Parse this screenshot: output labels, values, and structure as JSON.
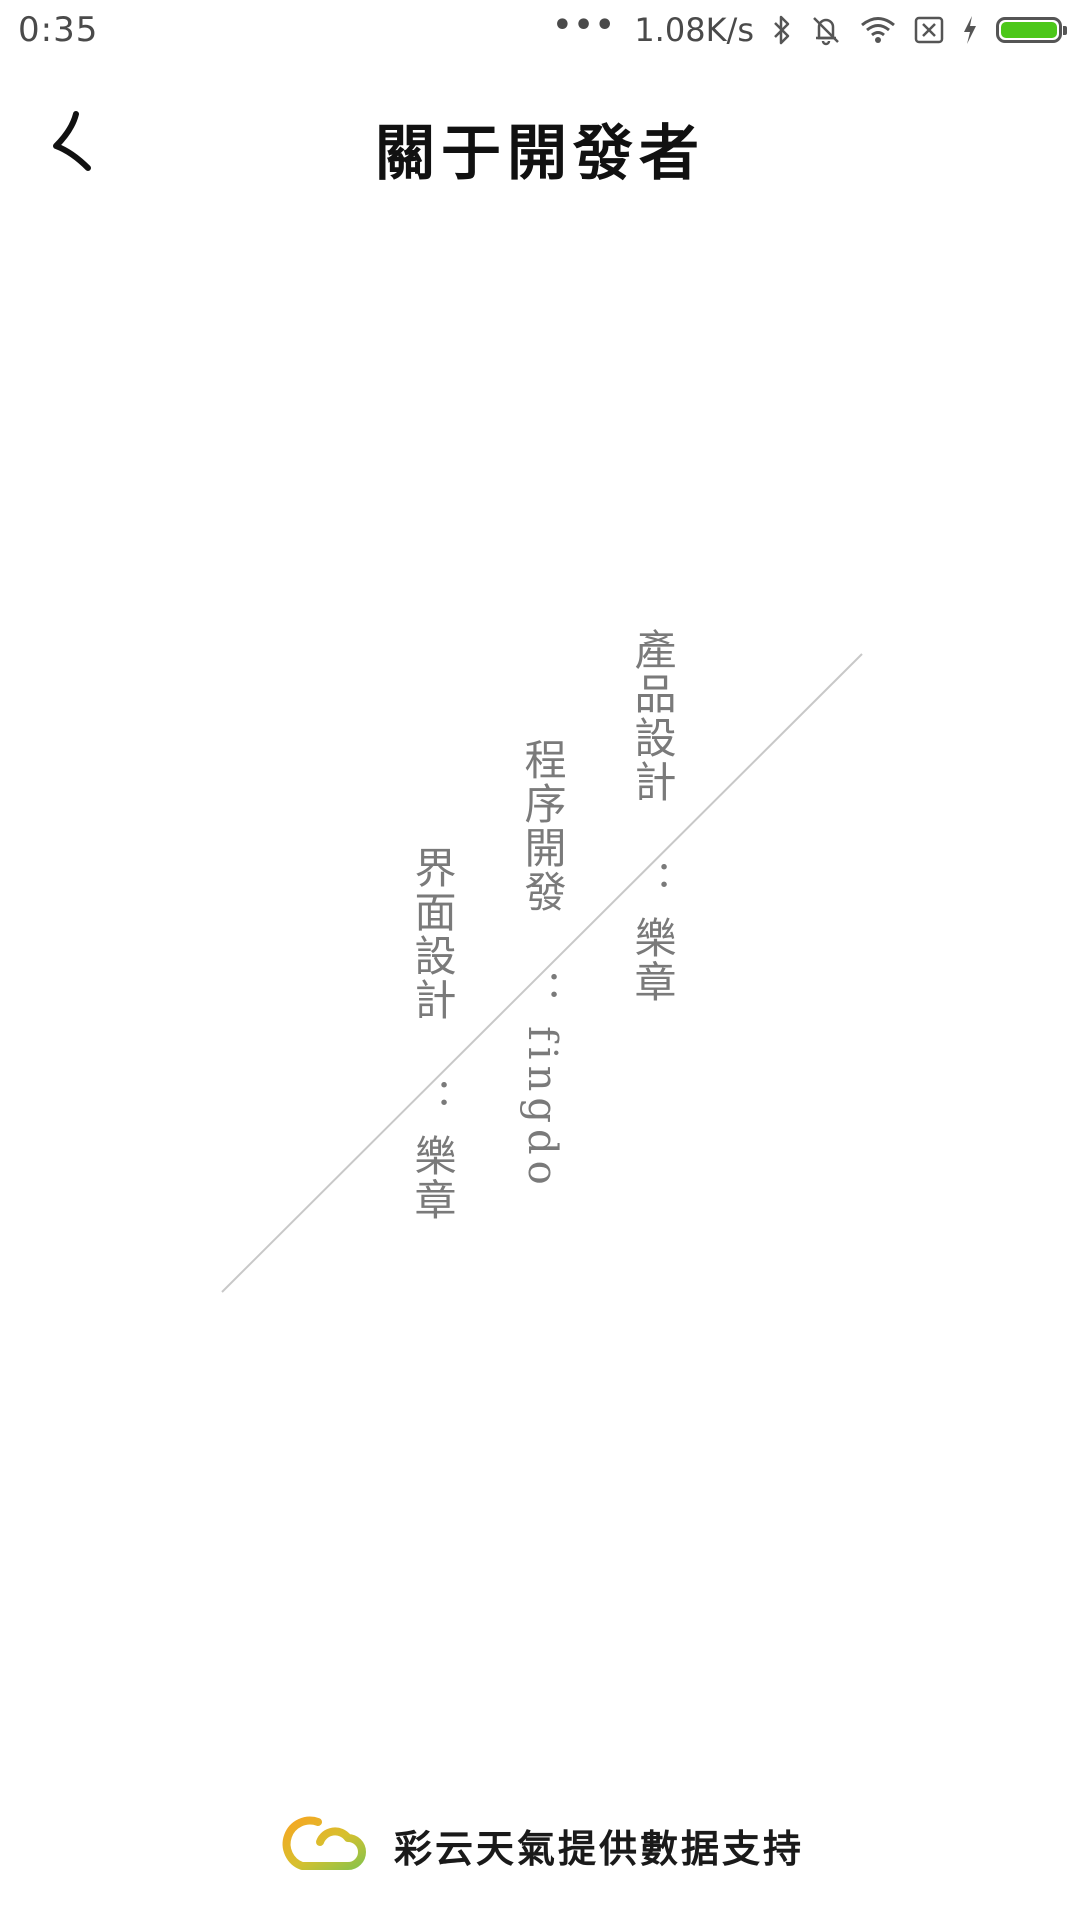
{
  "status_bar": {
    "time": "0:35",
    "dots": "•••",
    "net_speed": "1.08K/s",
    "icons": [
      "bluetooth-icon",
      "vibrate-off-icon",
      "wifi-icon",
      "sim-off-icon",
      "charging-icon",
      "battery-icon"
    ],
    "battery_level": 1.0,
    "battery_color": "#4cc71a"
  },
  "header": {
    "back_icon": "back-arrow-icon",
    "title": "關于開發者"
  },
  "credits": [
    {
      "role": "產品設計",
      "separator": "：",
      "name": "樂章"
    },
    {
      "role": "程序開發",
      "separator": "：",
      "name": "fingdo"
    },
    {
      "role": "界面設計",
      "separator": "：",
      "name": "樂章"
    }
  ],
  "footer": {
    "logo_icon": "caiyun-cloud-logo-icon",
    "text": "彩云天氣提供數据支持"
  },
  "colors": {
    "credit_text": "#7a7a7a",
    "divider": "#c8c8c8",
    "logo_orange": "#f5a623",
    "logo_green": "#8bc34a"
  }
}
